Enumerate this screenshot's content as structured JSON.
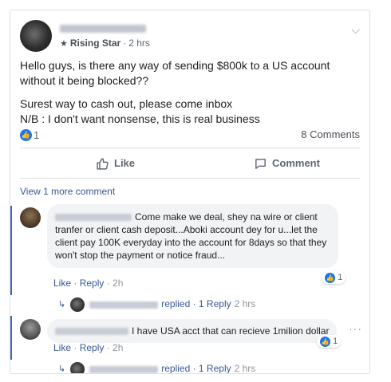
{
  "post": {
    "badge_label": "Rising Star",
    "time": "2 hrs",
    "line1": "Hello guys, is there any way of sending $800k to a US account without it being blocked??",
    "line2": "Surest way to cash out, please come inbox",
    "line3": "N/B : I don't want nonsense, this is real business",
    "reactions_count": "1",
    "comments_count": "8 Comments"
  },
  "actions": {
    "like_label": "Like",
    "comment_label": "Comment"
  },
  "comments": {
    "view_more": "View 1 more comment",
    "c1": {
      "text": "Come make we deal, shey na wire or client tranfer or client cash deposit...Aboki account dey for u...let the client pay 100K everyday into the account for 8days so that they won't stop the payment or notice fraud...",
      "reactions": "1",
      "like": "Like",
      "reply": "Reply",
      "time": "2h",
      "replied_label": "replied",
      "reply_count": "1 Reply",
      "reply_time": "2 hrs"
    },
    "c2": {
      "text": "I have USA acct that can recieve 1milion dollar",
      "reactions": "1",
      "like": "Like",
      "reply": "Reply",
      "time": "2h",
      "replied_label": "replied",
      "reply_count": "1 Reply",
      "reply_time": "2 hrs"
    }
  },
  "icons": {
    "badge": "star-badge-icon",
    "chevron": "chevron-down-icon",
    "like": "thumbs-up-icon",
    "comment": "comment-bubble-icon",
    "reply_arrow": "reply-arrow-icon",
    "more": "more-options-icon"
  },
  "colors": {
    "link": "#385898",
    "brand_blue": "#1877f2",
    "thread_bar": "#4267b2",
    "bubble_bg": "#f2f3f5"
  }
}
